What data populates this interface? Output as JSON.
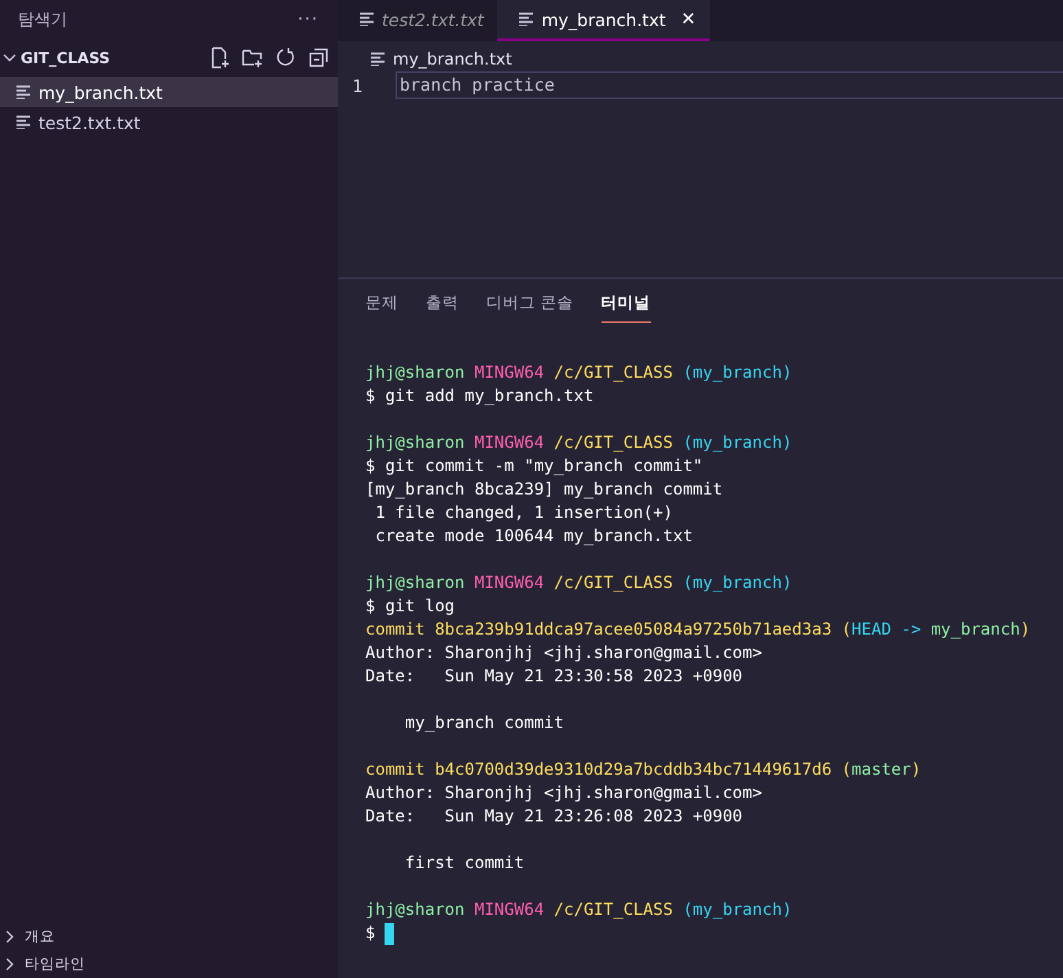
{
  "sidebar": {
    "title": "탐색기",
    "more": "···",
    "folder": {
      "name": "GIT_CLASS",
      "expanded": true,
      "files": [
        {
          "name": "my_branch.txt",
          "selected": true
        },
        {
          "name": "test2.txt.txt",
          "selected": false
        }
      ]
    },
    "sections": [
      {
        "name": "개요",
        "expanded": false
      },
      {
        "name": "타임라인",
        "expanded": false
      }
    ]
  },
  "tabs": [
    {
      "label": "test2.txt.txt",
      "selected": false,
      "preview": true
    },
    {
      "label": "my_branch.txt",
      "selected": true,
      "preview": false
    }
  ],
  "close": "✕",
  "editor": {
    "breadcrumb": "my_branch.txt",
    "lines": [
      {
        "number": "1",
        "text": "branch practice"
      }
    ]
  },
  "panel_tabs": [
    {
      "label": "문제",
      "selected": false
    },
    {
      "label": "출력",
      "selected": false
    },
    {
      "label": "디버그 콘솔",
      "selected": false
    },
    {
      "label": "터미널",
      "selected": true
    }
  ],
  "terminal": {
    "blocks": [
      [
        [
          {
            "text": "jhj@sharon ",
            "color": "#8ff0a4"
          },
          {
            "text": "MINGW64 ",
            "color": "#ff5fae"
          },
          {
            "text": "/c/GIT_CLASS ",
            "color": "#fede5d"
          },
          {
            "text": "(my_branch)",
            "color": "#36d6f0"
          }
        ],
        [
          {
            "text": "$ git add my_branch.txt",
            "color": "#ffffff"
          }
        ]
      ],
      [
        [
          {
            "text": "jhj@sharon ",
            "color": "#8ff0a4"
          },
          {
            "text": "MINGW64 ",
            "color": "#ff5fae"
          },
          {
            "text": "/c/GIT_CLASS ",
            "color": "#fede5d"
          },
          {
            "text": "(my_branch)",
            "color": "#36d6f0"
          }
        ],
        [
          {
            "text": "$ git commit -m \"my_branch commit\"",
            "color": "#ffffff"
          }
        ],
        [
          {
            "text": "[my_branch 8bca239] my_branch commit",
            "color": "#ffffff"
          }
        ],
        [
          {
            "text": " 1 file changed, 1 insertion(+)",
            "color": "#ffffff"
          }
        ],
        [
          {
            "text": " create mode 100644 my_branch.txt",
            "color": "#ffffff"
          }
        ]
      ],
      [
        [
          {
            "text": "jhj@sharon ",
            "color": "#8ff0a4"
          },
          {
            "text": "MINGW64 ",
            "color": "#ff5fae"
          },
          {
            "text": "/c/GIT_CLASS ",
            "color": "#fede5d"
          },
          {
            "text": "(my_branch)",
            "color": "#36d6f0"
          }
        ],
        [
          {
            "text": "$ git log",
            "color": "#ffffff"
          }
        ],
        [
          {
            "text": "commit 8bca239b91ddca97acee05084a97250b71aed3a3 ",
            "color": "#fede5d"
          },
          {
            "text": "(",
            "color": "#fede5d"
          },
          {
            "text": "HEAD -> ",
            "color": "#36d6f0"
          },
          {
            "text": "my_branch",
            "color": "#8ff0a4"
          },
          {
            "text": ")",
            "color": "#fede5d"
          }
        ],
        [
          {
            "text": "Author: Sharonjhj <jhj.sharon@gmail.com>",
            "color": "#ffffff"
          }
        ],
        [
          {
            "text": "Date:   Sun May 21 23:30:58 2023 +0900",
            "color": "#ffffff"
          }
        ]
      ],
      [
        [
          {
            "text": "    my_branch commit",
            "color": "#ffffff"
          }
        ]
      ],
      [
        [
          {
            "text": "commit b4c0700d39de9310d29a7bcddb34bc71449617d6 ",
            "color": "#fede5d"
          },
          {
            "text": "(",
            "color": "#fede5d"
          },
          {
            "text": "master",
            "color": "#8ff0a4"
          },
          {
            "text": ")",
            "color": "#fede5d"
          }
        ],
        [
          {
            "text": "Author: Sharonjhj <jhj.sharon@gmail.com>",
            "color": "#ffffff"
          }
        ],
        [
          {
            "text": "Date:   Sun May 21 23:26:08 2023 +0900",
            "color": "#ffffff"
          }
        ]
      ],
      [
        [
          {
            "text": "    first commit",
            "color": "#ffffff"
          }
        ]
      ],
      [
        [
          {
            "text": "jhj@sharon ",
            "color": "#8ff0a4"
          },
          {
            "text": "MINGW64 ",
            "color": "#ff5fae"
          },
          {
            "text": "/c/GIT_CLASS ",
            "color": "#fede5d"
          },
          {
            "text": "(my_branch)",
            "color": "#36d6f0"
          }
        ],
        [
          {
            "text": "$",
            "color": "#ffffff"
          }
        ]
      ]
    ],
    "cursor": true
  }
}
